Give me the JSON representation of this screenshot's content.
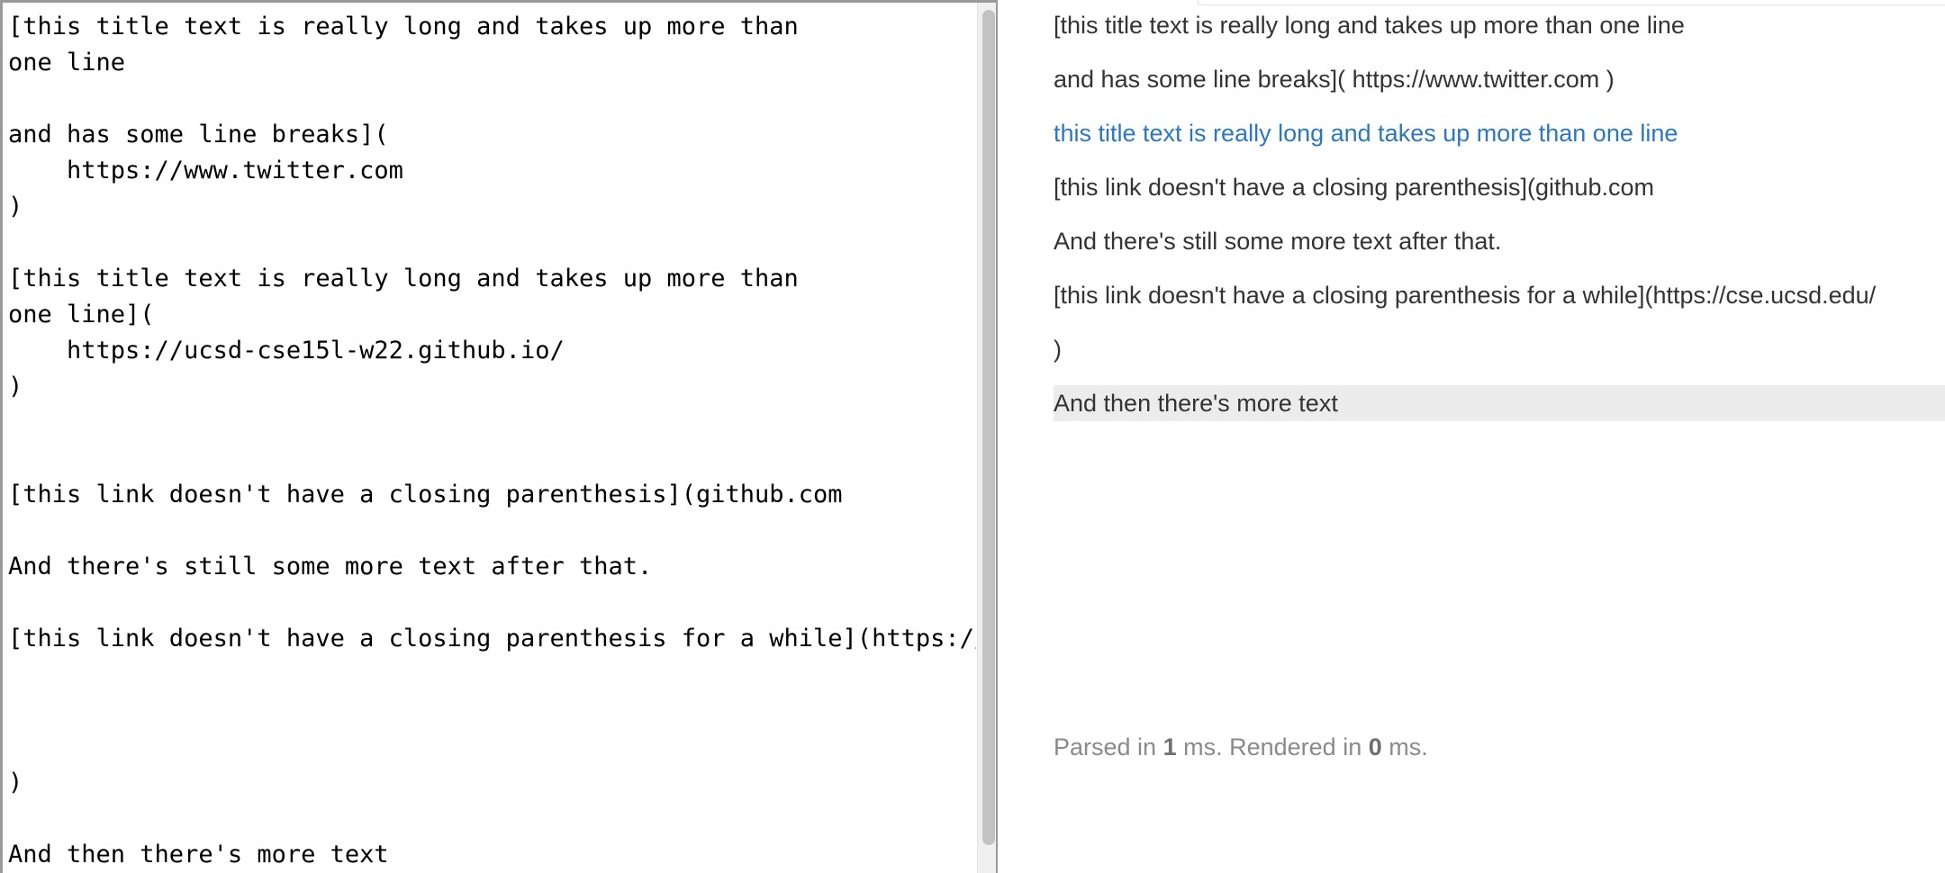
{
  "editor": {
    "lines": [
      "[this title text is really long and takes up more than",
      "one line",
      "",
      "and has some line breaks](",
      "    https://www.twitter.com",
      ")",
      "",
      "[this title text is really long and takes up more than",
      "one line](",
      "    https://ucsd-cse15l-w22.github.io/",
      ")",
      "",
      "",
      "[this link doesn't have a closing parenthesis](github.com",
      "",
      "And there's still some more text after that.",
      "",
      "[this link doesn't have a closing parenthesis for a while](https://cse.ucsd.edu/",
      "",
      "",
      "",
      ")",
      "",
      "And then there's more text"
    ]
  },
  "preview": {
    "line1": "[this title text is really long and takes up more than one line",
    "line2": "and has some line breaks]( https://www.twitter.com )",
    "link_text": "this title text is really long and takes up more than one line",
    "line4": "[this link doesn't have a closing parenthesis](github.com",
    "line5": "And there's still some more text after that.",
    "line6": "[this link doesn't have a closing parenthesis for a while](https://cse.ucsd.edu/",
    "line7": ")",
    "line8": "And then there's more text",
    "link_color": "#2a78c2",
    "highlight_color": "#ececec"
  },
  "timing": {
    "parsed_prefix": "Parsed in ",
    "parsed_value": "1",
    "middle": " ms. Rendered in ",
    "rendered_value": "0",
    "suffix": " ms."
  }
}
